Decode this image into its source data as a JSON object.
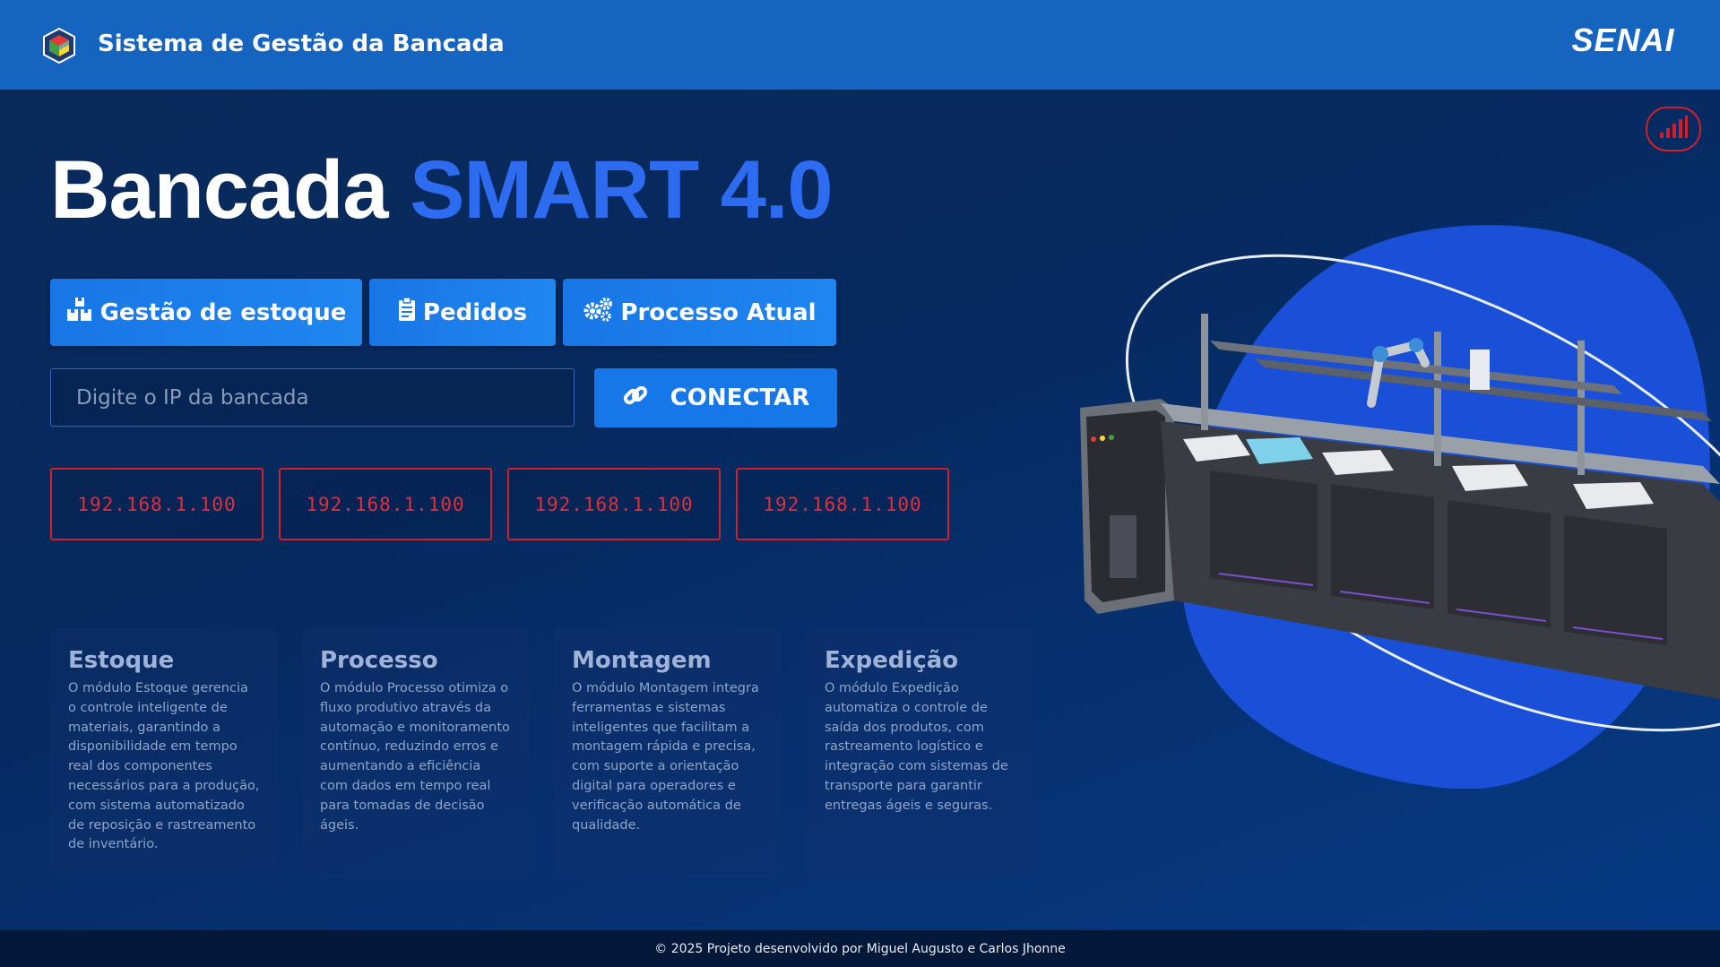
{
  "header": {
    "app_title": "Sistema de Gestão da Bancada",
    "brand": "SENAI"
  },
  "hero": {
    "title_part1": "Bancada",
    "title_part2": "SMART 4.0"
  },
  "nav": {
    "stock_label": "Gestão de estoque",
    "orders_label": "Pedidos",
    "process_label": "Processo Atual"
  },
  "connect": {
    "ip_placeholder": "Digite o IP da bancada",
    "ip_value": "",
    "button_label": "CONECTAR"
  },
  "ip_slots": [
    "192.168.1.100",
    "192.168.1.100",
    "192.168.1.100",
    "192.168.1.100"
  ],
  "modules": [
    {
      "title": "Estoque",
      "text": "O módulo Estoque gerencia o controle inteligente de materiais, garantindo a disponibilidade em tempo real dos componentes necessários para a produção, com sistema automatizado de reposição e rastreamento de inventário."
    },
    {
      "title": "Processo",
      "text": "O módulo Processo otimiza o fluxo produtivo através da automação e monitoramento contínuo, reduzindo erros e aumentando a eficiência com dados em tempo real para tomadas de decisão ágeis."
    },
    {
      "title": "Montagem",
      "text": "O módulo Montagem integra ferramentas e sistemas inteligentes que facilitam a montagem rápida e precisa, com suporte a orientação digital para operadores e verificação automática de qualidade."
    },
    {
      "title": "Expedição",
      "text": "O módulo Expedição automatiza o controle de saída dos produtos, com rastreamento logístico e integração com sistemas de transporte para garantir entregas ágeis e seguras."
    }
  ],
  "footer": {
    "text": "© 2025 Projeto desenvolvido por Miguel Augusto e Carlos Jhonne"
  },
  "colors": {
    "header_bg": "#1565c0",
    "accent_blue": "#2d6cf0",
    "button_blue": "#1678e8",
    "alert_red": "#d0202a",
    "footer_bg": "#04183a"
  },
  "icons": {
    "logo": "cube-logo-icon",
    "signal": "signal-bars-icon",
    "stock": "boxes-icon",
    "orders": "clipboard-icon",
    "process": "gears-icon",
    "connect": "link-icon"
  }
}
